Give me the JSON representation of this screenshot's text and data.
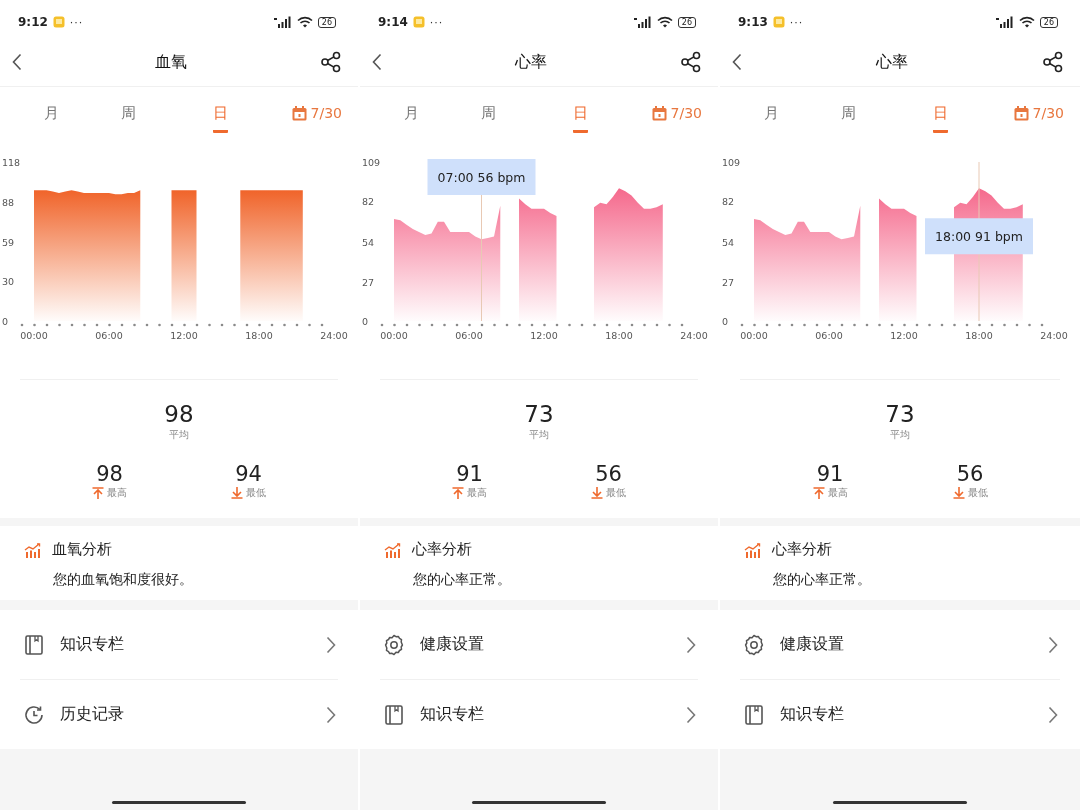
{
  "screens": [
    {
      "status_bar": {
        "time": "9:12",
        "more": "···",
        "battery": "26"
      },
      "title": "血氧",
      "tabs": [
        {
          "label": "月",
          "selected": false
        },
        {
          "label": "周",
          "selected": false
        },
        {
          "label": "日",
          "selected": true
        }
      ],
      "date": "7/30",
      "chart_data": {
        "type": "area",
        "xlim": [
          0,
          24
        ],
        "ylim": [
          0,
          118
        ],
        "x": [
          0,
          0.5,
          1,
          1.5,
          2,
          2.5,
          3,
          3.5,
          4,
          4.5,
          5,
          5.5,
          6,
          6.5,
          7,
          7.5,
          8,
          8.5,
          9,
          9.5,
          10,
          10.5,
          11,
          11.5,
          12,
          12.5,
          13,
          13.5,
          14,
          14.5,
          15,
          15.5,
          16,
          16.5,
          17,
          17.5,
          18,
          18.5,
          19,
          19.5,
          20,
          20.5,
          21,
          21.5
        ],
        "series": [
          {
            "color": "#f0642a",
            "values": [
              97,
              97,
              97,
              96,
              95,
              96,
              97,
              96,
              95,
              95,
              95,
              95,
              95,
              94,
              94,
              95,
              95,
              97,
              null,
              null,
              null,
              null,
              97,
              97,
              97,
              97,
              97,
              null,
              null,
              null,
              null,
              null,
              null,
              97,
              97,
              97,
              97,
              97,
              97,
              97,
              97,
              97,
              97,
              97
            ]
          }
        ],
        "xticks": [
          {
            "value": 0,
            "label": "00:00"
          },
          {
            "value": 6,
            "label": "06:00"
          },
          {
            "value": 12,
            "label": "12:00"
          },
          {
            "value": 18,
            "label": "18:00"
          },
          {
            "value": 24,
            "label": "24:00"
          }
        ],
        "yticks": [
          0,
          30,
          59,
          88,
          118
        ]
      },
      "average": {
        "value": "98",
        "label": "平均"
      },
      "max": {
        "value": "98",
        "label": "最高"
      },
      "min": {
        "value": "94",
        "label": "最低"
      },
      "analysis": {
        "title": "血氧分析",
        "text": "您的血氧饱和度很好。"
      },
      "menu": [
        {
          "kind": "book",
          "label": "知识专栏"
        },
        {
          "kind": "history",
          "label": "历史记录"
        }
      ]
    },
    {
      "status_bar": {
        "time": "9:14",
        "more": "···",
        "battery": "26"
      },
      "title": "心率",
      "tabs": [
        {
          "label": "月",
          "selected": false
        },
        {
          "label": "周",
          "selected": false
        },
        {
          "label": "日",
          "selected": true
        }
      ],
      "date": "7/30",
      "chart_data": {
        "type": "area",
        "xlim": [
          0,
          24
        ],
        "ylim": [
          0,
          109
        ],
        "x": [
          0,
          0.5,
          1,
          1.5,
          2,
          2.5,
          3,
          3.5,
          4,
          4.5,
          5,
          5.5,
          6,
          6.5,
          7,
          7.5,
          8,
          8.5,
          9,
          9.5,
          10,
          10.5,
          11,
          11.5,
          12,
          12.5,
          13,
          13.5,
          14,
          14.5,
          15,
          15.5,
          16,
          16.5,
          17,
          17.5,
          18,
          18.5,
          19,
          19.5,
          20,
          20.5,
          21,
          21.5
        ],
        "series": [
          {
            "color": "#f5698c",
            "values": [
              70,
              69,
              66,
              63,
              61,
              59,
              60,
              68,
              68,
              61,
              61,
              61,
              61,
              58,
              56,
              57,
              58,
              79,
              null,
              null,
              84,
              80,
              77,
              77,
              77,
              74,
              72,
              null,
              null,
              null,
              null,
              null,
              78,
              81,
              80,
              85,
              91,
              89,
              86,
              81,
              77,
              77,
              78,
              80
            ]
          }
        ],
        "xticks": [
          {
            "value": 0,
            "label": "00:00"
          },
          {
            "value": 6,
            "label": "06:00"
          },
          {
            "value": 12,
            "label": "12:00"
          },
          {
            "value": 18,
            "label": "18:00"
          },
          {
            "value": 24,
            "label": "24:00"
          }
        ],
        "yticks": [
          0,
          27,
          54,
          82,
          109
        ],
        "ref_lines": [
          {
            "axis": "x",
            "value": 7
          }
        ],
        "annotations": [
          "07:00 56 bpm"
        ]
      },
      "average": {
        "value": "73",
        "label": "平均"
      },
      "max": {
        "value": "91",
        "label": "最高"
      },
      "min": {
        "value": "56",
        "label": "最低"
      },
      "analysis": {
        "title": "心率分析",
        "text": "您的心率正常。"
      },
      "menu": [
        {
          "kind": "settings",
          "label": "健康设置"
        },
        {
          "kind": "book",
          "label": "知识专栏"
        }
      ]
    },
    {
      "status_bar": {
        "time": "9:13",
        "more": "···",
        "battery": "26"
      },
      "title": "心率",
      "tabs": [
        {
          "label": "月",
          "selected": false
        },
        {
          "label": "周",
          "selected": false
        },
        {
          "label": "日",
          "selected": true
        }
      ],
      "date": "7/30",
      "chart_data": {
        "type": "area",
        "xlim": [
          0,
          24
        ],
        "ylim": [
          0,
          109
        ],
        "x": [
          0,
          0.5,
          1,
          1.5,
          2,
          2.5,
          3,
          3.5,
          4,
          4.5,
          5,
          5.5,
          6,
          6.5,
          7,
          7.5,
          8,
          8.5,
          9,
          9.5,
          10,
          10.5,
          11,
          11.5,
          12,
          12.5,
          13,
          13.5,
          14,
          14.5,
          15,
          15.5,
          16,
          16.5,
          17,
          17.5,
          18,
          18.5,
          19,
          19.5,
          20,
          20.5,
          21,
          21.5
        ],
        "series": [
          {
            "color": "#f5698c",
            "values": [
              70,
              69,
              66,
              63,
              61,
              59,
              60,
              68,
              68,
              61,
              61,
              61,
              61,
              58,
              56,
              57,
              58,
              79,
              null,
              null,
              84,
              80,
              77,
              77,
              77,
              74,
              72,
              null,
              null,
              null,
              null,
              null,
              78,
              81,
              80,
              85,
              91,
              89,
              86,
              81,
              77,
              77,
              78,
              80
            ]
          }
        ],
        "xticks": [
          {
            "value": 0,
            "label": "00:00"
          },
          {
            "value": 6,
            "label": "06:00"
          },
          {
            "value": 12,
            "label": "12:00"
          },
          {
            "value": 18,
            "label": "18:00"
          },
          {
            "value": 24,
            "label": "24:00"
          }
        ],
        "yticks": [
          0,
          27,
          54,
          82,
          109
        ],
        "ref_lines": [
          {
            "axis": "x",
            "value": 18
          }
        ],
        "annotations": [
          "18:00 91 bpm"
        ]
      },
      "average": {
        "value": "73",
        "label": "平均"
      },
      "max": {
        "value": "91",
        "label": "最高"
      },
      "min": {
        "value": "56",
        "label": "最低"
      },
      "analysis": {
        "title": "心率分析",
        "text": "您的心率正常。"
      },
      "menu": [
        {
          "kind": "settings",
          "label": "健康设置"
        },
        {
          "kind": "book",
          "label": "知识专栏"
        }
      ]
    }
  ]
}
